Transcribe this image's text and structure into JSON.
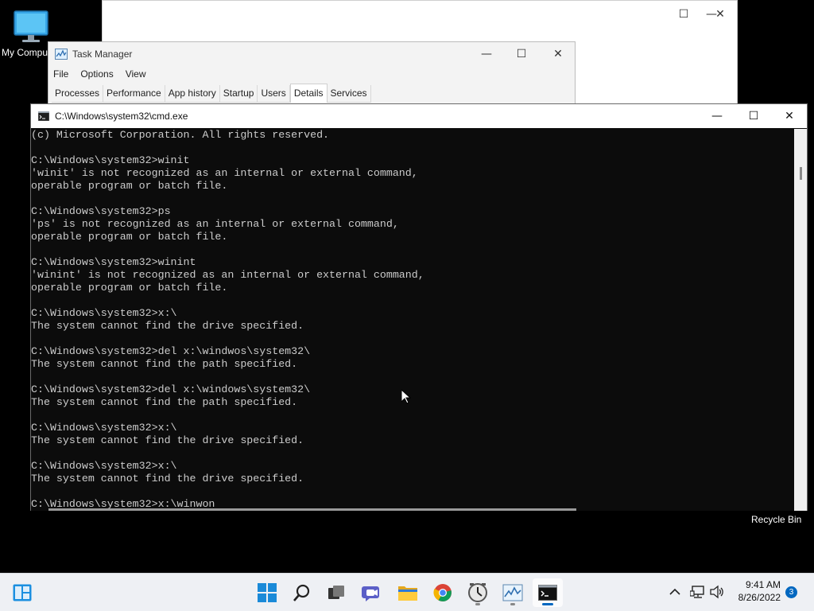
{
  "desktop": {
    "icons": [
      {
        "label": "My Computer"
      },
      {
        "label": "Recycle Bin"
      }
    ]
  },
  "task_manager": {
    "title": "Task Manager",
    "menu": [
      "File",
      "Options",
      "View"
    ],
    "tabs": [
      "Processes",
      "Performance",
      "App history",
      "Startup",
      "Users",
      "Details",
      "Services"
    ],
    "active_tab": "Details"
  },
  "cmd": {
    "title": "C:\\Windows\\system32\\cmd.exe",
    "lines": [
      "(c) Microsoft Corporation. All rights reserved.",
      "",
      "C:\\Windows\\system32>winit",
      "'winit' is not recognized as an internal or external command,",
      "operable program or batch file.",
      "",
      "C:\\Windows\\system32>ps",
      "'ps' is not recognized as an internal or external command,",
      "operable program or batch file.",
      "",
      "C:\\Windows\\system32>winint",
      "'winint' is not recognized as an internal or external command,",
      "operable program or batch file.",
      "",
      "C:\\Windows\\system32>x:\\",
      "The system cannot find the drive specified.",
      "",
      "C:\\Windows\\system32>del x:\\windwos\\system32\\",
      "The system cannot find the path specified.",
      "",
      "C:\\Windows\\system32>del x:\\windows\\system32\\",
      "The system cannot find the path specified.",
      "",
      "C:\\Windows\\system32>x:\\",
      "The system cannot find the drive specified.",
      "",
      "C:\\Windows\\system32>x:\\",
      "The system cannot find the drive specified.",
      "",
      "C:\\Windows\\system32>x:\\winwon"
    ]
  },
  "window_controls": {
    "minimize": "—",
    "maximize": "☐",
    "close": "✕"
  },
  "taskbar": {
    "apps": [
      {
        "name": "start",
        "icon": "windows-logo-icon"
      },
      {
        "name": "search",
        "icon": "search-icon"
      },
      {
        "name": "task-view",
        "icon": "task-view-icon"
      },
      {
        "name": "chat",
        "icon": "chat-icon"
      },
      {
        "name": "file-explorer",
        "icon": "folder-icon"
      },
      {
        "name": "chrome",
        "icon": "chrome-icon"
      },
      {
        "name": "clock-app",
        "icon": "clock-icon"
      },
      {
        "name": "task-manager",
        "icon": "task-manager-icon"
      },
      {
        "name": "cmd",
        "icon": "cmd-icon"
      }
    ],
    "time": "9:41 AM",
    "date": "8/26/2022",
    "notification_count": "3",
    "accent": "#0067c0"
  }
}
